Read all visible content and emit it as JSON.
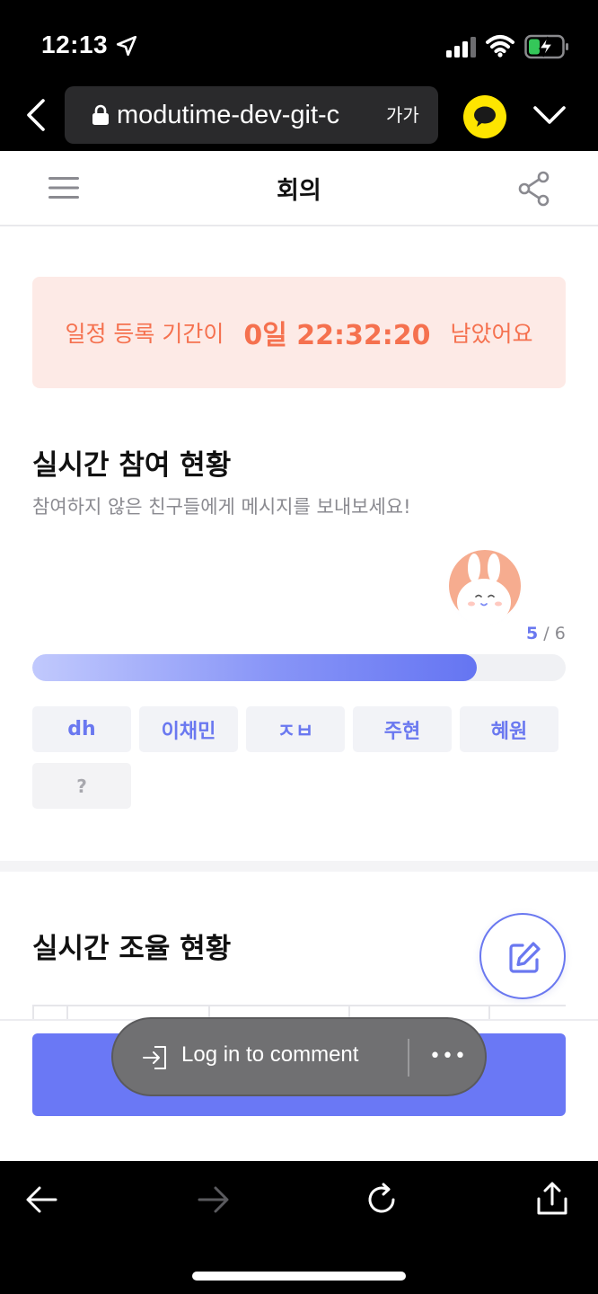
{
  "status_bar": {
    "time": "12:13",
    "icons": [
      "location-arrow-icon",
      "signal-icon",
      "wifi-icon",
      "battery-charging-icon"
    ]
  },
  "browser": {
    "url": "modutime-dev-git-c",
    "text_size_label": "가가",
    "icons": [
      "back-chevron-icon",
      "lock-icon",
      "kakao-talk-icon",
      "chevron-down-icon"
    ]
  },
  "header": {
    "title": "회의",
    "icons": [
      "hamburger-menu-icon",
      "share-icon"
    ]
  },
  "countdown": {
    "prefix": "일정 등록 기간이",
    "time": "0일 22:32:20",
    "suffix": "남았어요"
  },
  "participation": {
    "title": "실시간 참여 현황",
    "subtitle": "참여하지 않은 친구들에게 메시지를 보내보세요!",
    "joined": "5",
    "separator": " / ",
    "total": "6",
    "progress_fraction": 0.833,
    "members": [
      {
        "name": "dh",
        "joined": true
      },
      {
        "name": "이채민",
        "joined": true
      },
      {
        "name": "ㅈㅂ",
        "joined": true
      },
      {
        "name": "주현",
        "joined": true
      },
      {
        "name": "혜원",
        "joined": true
      },
      {
        "name": "?",
        "joined": false
      }
    ]
  },
  "schedule": {
    "title": "실시간 조율 현황"
  },
  "comment_bar": {
    "label": "Log in to comment",
    "more": "•••"
  },
  "colors": {
    "accent": "#6a78f5",
    "countdown_bg": "#fdeae6",
    "countdown_text": "#f5714f",
    "kakao_yellow": "#fee500"
  }
}
